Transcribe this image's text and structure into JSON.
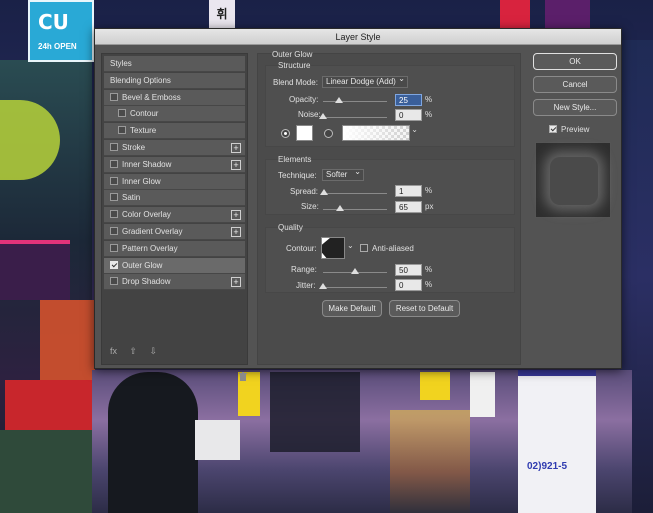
{
  "background": {
    "sign_brand": "CU",
    "sign_open": "24h OPEN",
    "sign_top": "휘",
    "pillar_number": "02)921-5"
  },
  "dialog": {
    "title": "Layer Style",
    "styles_list": [
      {
        "label": "Styles",
        "checkbox": false,
        "checked": false,
        "plus": false,
        "indent": false
      },
      {
        "label": "Blending Options",
        "checkbox": false,
        "checked": false,
        "plus": false,
        "indent": false
      },
      {
        "label": "Bevel & Emboss",
        "checkbox": true,
        "checked": false,
        "plus": false,
        "indent": false
      },
      {
        "label": "Contour",
        "checkbox": true,
        "checked": false,
        "plus": false,
        "indent": true
      },
      {
        "label": "Texture",
        "checkbox": true,
        "checked": false,
        "plus": false,
        "indent": true
      },
      {
        "label": "Stroke",
        "checkbox": true,
        "checked": false,
        "plus": true,
        "indent": false
      },
      {
        "label": "Inner Shadow",
        "checkbox": true,
        "checked": false,
        "plus": true,
        "indent": false
      },
      {
        "label": "Inner Glow",
        "checkbox": true,
        "checked": false,
        "plus": false,
        "indent": false
      },
      {
        "label": "Satin",
        "checkbox": true,
        "checked": false,
        "plus": false,
        "indent": false
      },
      {
        "label": "Color Overlay",
        "checkbox": true,
        "checked": false,
        "plus": true,
        "indent": false
      },
      {
        "label": "Gradient Overlay",
        "checkbox": true,
        "checked": false,
        "plus": true,
        "indent": false
      },
      {
        "label": "Pattern Overlay",
        "checkbox": true,
        "checked": false,
        "plus": false,
        "indent": false
      },
      {
        "label": "Outer Glow",
        "checkbox": true,
        "checked": true,
        "plus": false,
        "indent": false,
        "selected": true
      },
      {
        "label": "Drop Shadow",
        "checkbox": true,
        "checked": false,
        "plus": true,
        "indent": false
      }
    ],
    "fx_icons": [
      "fx",
      "⇧",
      "⇩"
    ],
    "trash_icon": "🗑",
    "outer_glow": {
      "heading": "Outer Glow",
      "structure": {
        "heading": "Structure",
        "blend_mode_label": "Blend Mode:",
        "blend_mode_value": "Linear Dodge (Add)",
        "opacity_label": "Opacity:",
        "opacity_value": "25",
        "opacity_level": 25,
        "noise_label": "Noise:",
        "noise_value": "0",
        "noise_level": 0,
        "unit_percent": "%",
        "color": "#ffffff"
      },
      "elements": {
        "heading": "Elements",
        "technique_label": "Technique:",
        "technique_value": "Softer",
        "spread_label": "Spread:",
        "spread_value": "1",
        "spread_level": 1,
        "size_label": "Size:",
        "size_value": "65",
        "size_level": 26,
        "unit_percent": "%",
        "unit_px": "px"
      },
      "quality": {
        "heading": "Quality",
        "contour_label": "Contour:",
        "anti_aliased_label": "Anti-aliased",
        "anti_aliased_checked": false,
        "range_label": "Range:",
        "range_value": "50",
        "range_level": 50,
        "jitter_label": "Jitter:",
        "jitter_value": "0",
        "jitter_level": 0,
        "unit_percent": "%"
      },
      "make_default": "Make Default",
      "reset_default": "Reset to Default"
    },
    "buttons": {
      "ok": "OK",
      "cancel": "Cancel",
      "new_style": "New Style...",
      "preview_label": "Preview",
      "preview_checked": true
    }
  }
}
